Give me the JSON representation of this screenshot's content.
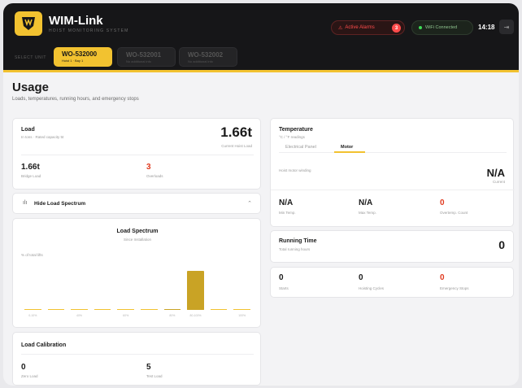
{
  "header": {
    "app_title": "WIM-Link",
    "app_subtitle": "HOIST MONITORING SYSTEM",
    "alarm_label": "Active Alarms",
    "alarm_count": "3",
    "wifi_label": "WiFi Connected",
    "time": "14:18",
    "select_unit_label": "SELECT UNIT",
    "units": [
      {
        "name": "WO-532000",
        "sub": "Hoist 1 · Bay 1",
        "active": true
      },
      {
        "name": "WO-532001",
        "sub": "No additional info",
        "active": false
      },
      {
        "name": "WO-532002",
        "sub": "No additional info",
        "active": false
      }
    ]
  },
  "page": {
    "title": "Usage",
    "subtitle": "Loads, temperatures, running hours, and emergency stops"
  },
  "load": {
    "title": "Load",
    "subtitle": "In tons · Rated capacity 5t",
    "current_value": "1.66t",
    "current_label": "Current Hoist Load",
    "bridge_value": "1.66t",
    "bridge_label": "Bridge Load",
    "overloads_value": "3",
    "overloads_label": "Overloads"
  },
  "spectrum_toggle": {
    "label": "Hide Load Spectrum"
  },
  "spectrum": {
    "title": "Load Spectrum",
    "subtitle": "Since Installation",
    "ylabel": "% of total lifts"
  },
  "chart_data": {
    "type": "bar",
    "title": "Load Spectrum",
    "subtitle": "Since Installation",
    "ylabel": "% of total lifts",
    "categories": [
      "0-10%",
      "",
      "40%",
      "",
      "60%",
      "",
      "80%",
      "80-100%",
      "",
      "100%"
    ],
    "values": [
      0,
      0,
      0,
      0,
      0,
      0,
      0.5,
      23,
      0,
      0
    ],
    "ylim": [
      0,
      30
    ],
    "grid": false
  },
  "calibration": {
    "title": "Load Calibration",
    "zero_value": "0",
    "zero_label": "Zero Load",
    "test_value": "5",
    "test_label": "Test Load"
  },
  "temperature": {
    "title": "Temperature",
    "subtitle": "°C / °F readings",
    "tabs": [
      "Electrical Panel",
      "Motor"
    ],
    "active_tab": "Motor",
    "reading_label": "Hoist motor winding",
    "current_value": "N/A",
    "current_label": "Current",
    "min_value": "N/A",
    "min_label": "Min Temp.",
    "max_value": "N/A",
    "max_label": "Max Temp.",
    "overtemp_value": "0",
    "overtemp_label": "Overtemp. Count"
  },
  "running": {
    "title": "Running Time",
    "subtitle": "Total running hours",
    "value": "0"
  },
  "counters": {
    "starts_value": "0",
    "starts_label": "Starts",
    "hoisting_value": "0",
    "hoisting_label": "Hoisting Cycles",
    "estop_value": "0",
    "estop_label": "Emergency Stops"
  },
  "colors": {
    "accent": "#f2c230",
    "header_bg": "#161618",
    "alarm": "#ff4b4b",
    "wifi": "#3ddc56",
    "danger_text": "#e03a1f"
  }
}
